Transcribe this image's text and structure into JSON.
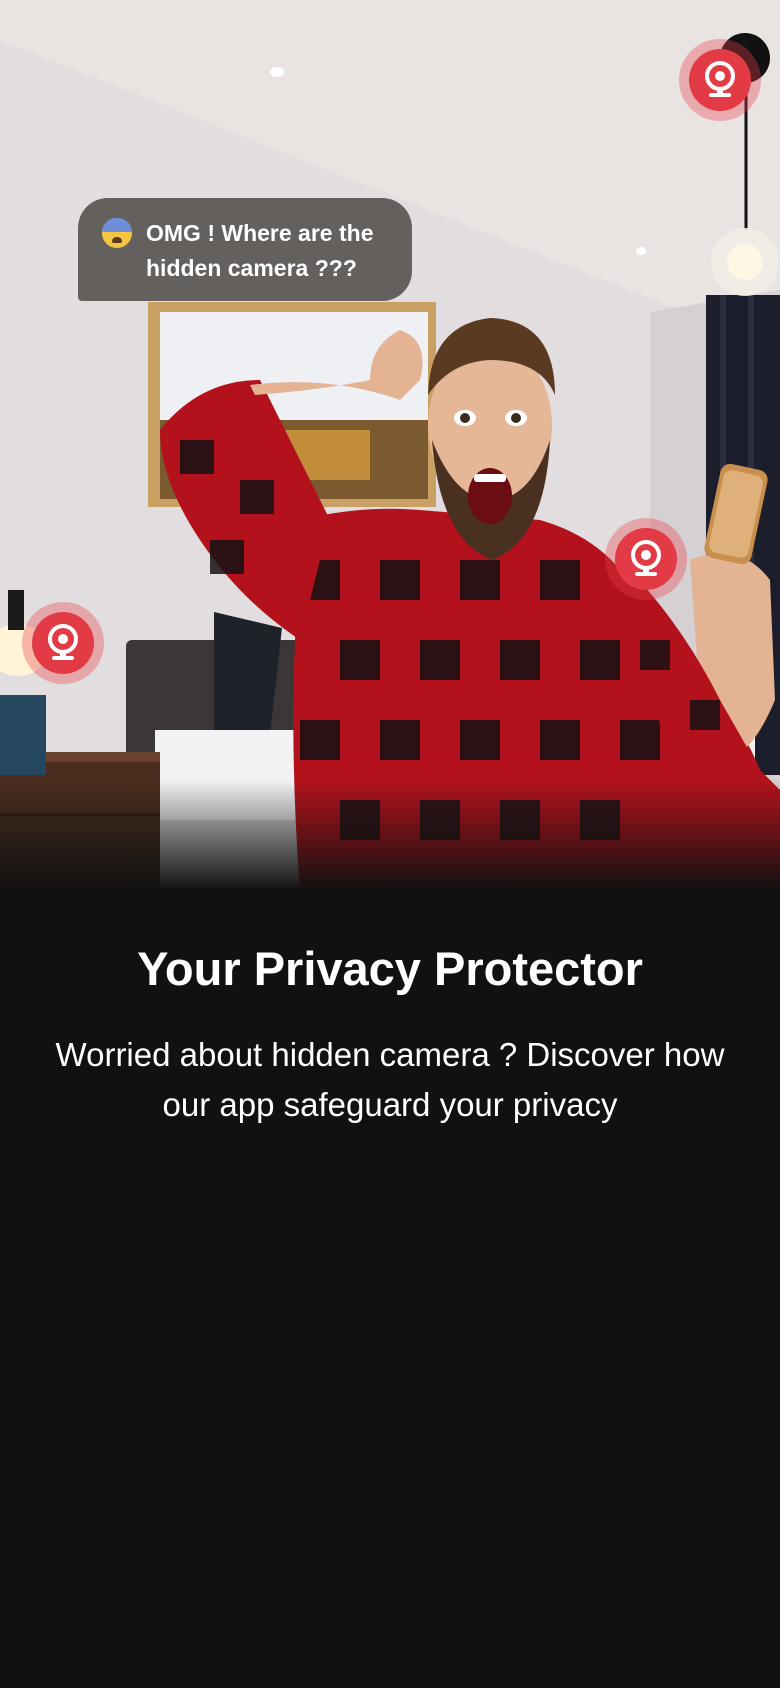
{
  "hero": {
    "image_alt": "Shocked man in a bedroom holding a phone",
    "bubble": {
      "emoji_icon": "fearful-face-icon",
      "text": "OMG ! Where are the\nhidden camera ???"
    },
    "camera_markers": [
      {
        "icon": "webcam-icon",
        "color": "#e33b45"
      },
      {
        "icon": "webcam-icon",
        "color": "#e33b45"
      },
      {
        "icon": "webcam-icon",
        "color": "#e33b45"
      }
    ]
  },
  "onboarding": {
    "title": "Your Privacy Protector",
    "description": "Worried about hidden camera ? Discover how our app safeguard your privacy"
  },
  "colors": {
    "background": "#111111",
    "accent": "#e33b45",
    "bubble": "#585552"
  }
}
